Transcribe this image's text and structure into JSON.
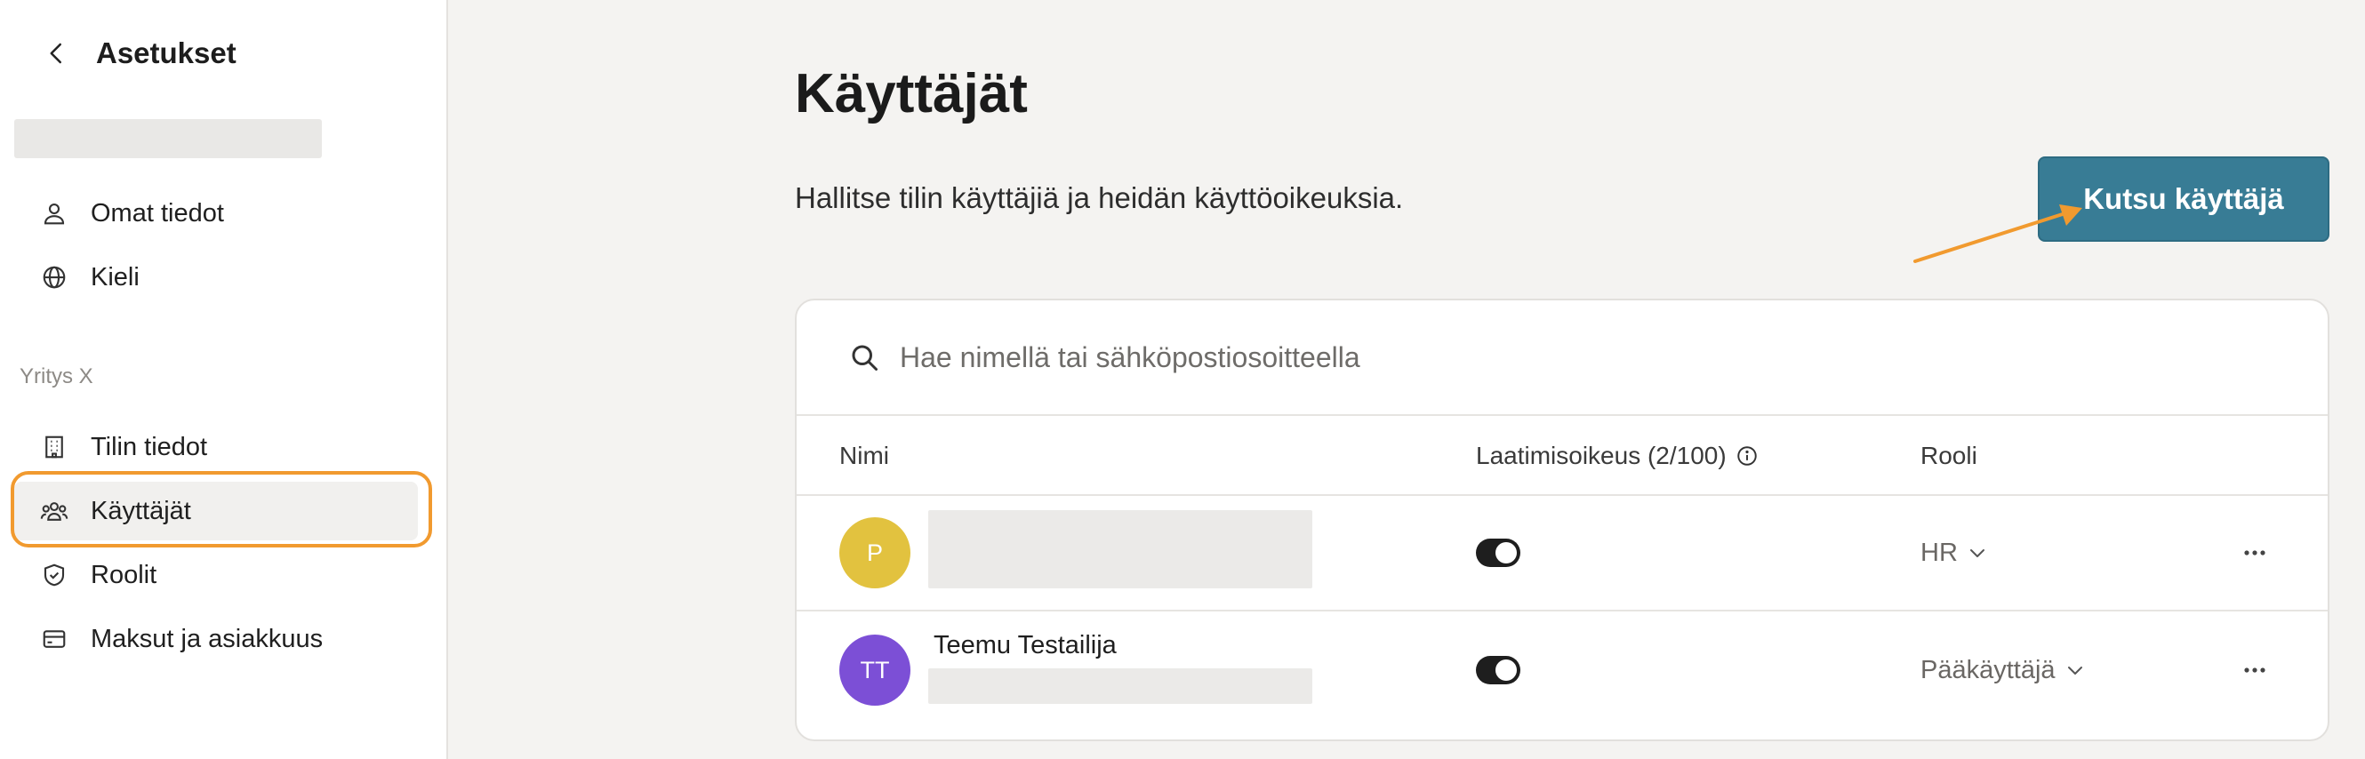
{
  "sidebar": {
    "title": "Asetukset",
    "items_top": [
      {
        "label": "Omat tiedot",
        "icon": "user-icon"
      },
      {
        "label": "Kieli",
        "icon": "globe-icon"
      }
    ],
    "section_label": "Yritys X",
    "items_company": [
      {
        "label": "Tilin tiedot",
        "icon": "building-icon"
      },
      {
        "label": "Käyttäjät",
        "icon": "users-icon",
        "active": true
      },
      {
        "label": "Roolit",
        "icon": "shield-icon"
      },
      {
        "label": "Maksut ja asiakkuus",
        "icon": "credit-card-icon"
      }
    ]
  },
  "main": {
    "title": "Käyttäjät",
    "subtitle": "Hallitse tilin käyttäjiä ja heidän käyttöoikeuksia.",
    "invite_button": "Kutsu käyttäjä",
    "search_placeholder": "Hae nimellä tai sähköpostiosoitteella",
    "columns": {
      "name": "Nimi",
      "drafting": "Laatimisoikeus (2/100)",
      "role": "Rooli"
    },
    "rows": [
      {
        "initials": "P",
        "avatar_color": "#e2c23f",
        "name": "",
        "drafting_enabled": true,
        "role": "HR"
      },
      {
        "initials": "TT",
        "avatar_color": "#7c4fd6",
        "name": "Teemu Testailija",
        "drafting_enabled": true,
        "role": "Pääkäyttäjä"
      }
    ]
  },
  "colors": {
    "accent": "#387c95",
    "highlight": "#f19a2f"
  }
}
